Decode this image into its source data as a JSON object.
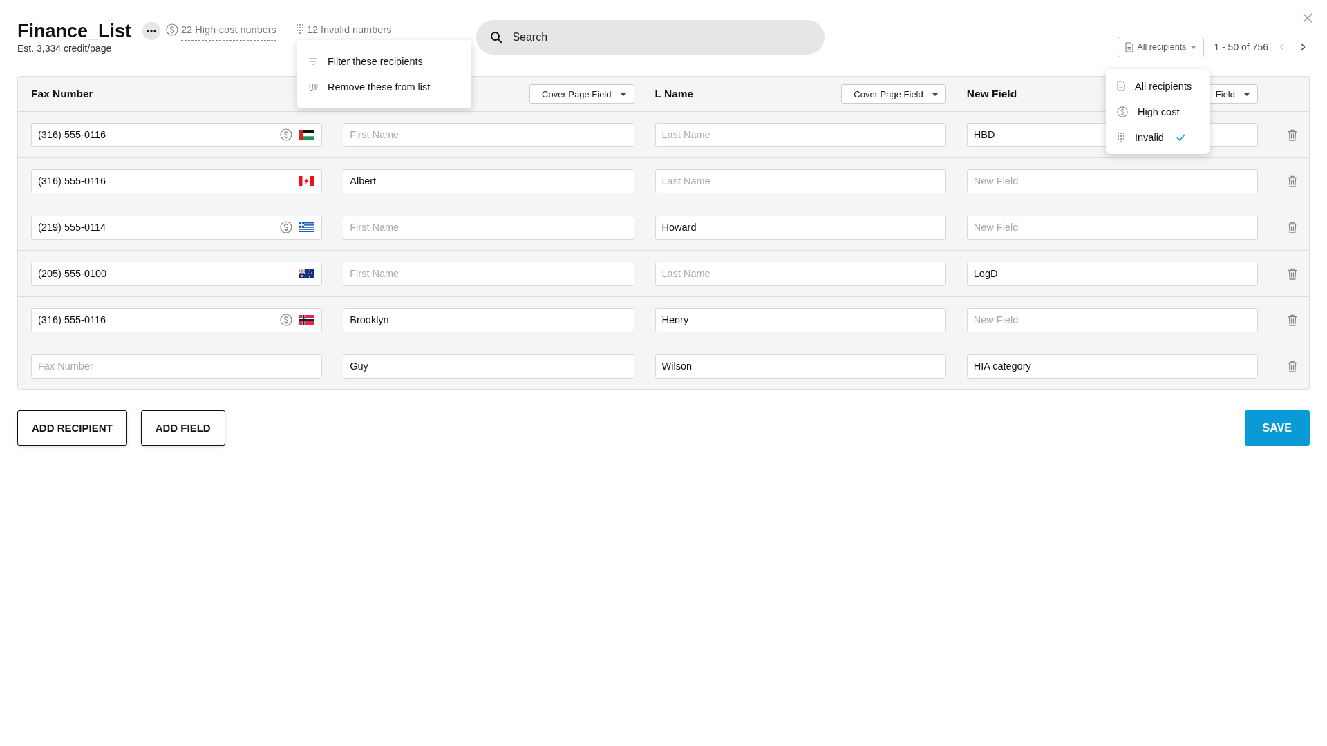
{
  "header": {
    "title": "Finance_List",
    "subtitle": "Est. 3,334 credit/page",
    "high_cost_label": "22 High-cost nunbers",
    "invalid_label": "12 Invalid numbers"
  },
  "invalid_menu": {
    "items": [
      {
        "kind": "filter",
        "label": "Filter these recipients"
      },
      {
        "kind": "remove",
        "label": "Remove these from list"
      }
    ]
  },
  "search": {
    "placeholder": "Search"
  },
  "filter": {
    "label": "All recipients",
    "options": [
      {
        "kind": "all",
        "label": "All recipients",
        "selected": false
      },
      {
        "kind": "high_cost",
        "label": "High cost",
        "selected": false
      },
      {
        "kind": "invalid",
        "label": "Invalid",
        "selected": true
      }
    ]
  },
  "pagination": {
    "range": "1 - 50 of 756",
    "prev_disabled": true
  },
  "table": {
    "columns": [
      {
        "label": "Fax Number"
      },
      {
        "field_select": "Cover Page Field"
      },
      {
        "label": "L Name",
        "field_select": "Cover Page Field"
      },
      {
        "label": "New Field",
        "field_select": "Field"
      }
    ],
    "rows": [
      {
        "cells": [
          {
            "value": "(316) 555-0116",
            "high_cost": true,
            "flag": {
              "kind": "ae"
            }
          },
          {
            "placeholder": "First Name"
          },
          {
            "placeholder": "Last Name"
          },
          {
            "value": "HBD"
          }
        ]
      },
      {
        "cells": [
          {
            "value": "(316) 555-0116",
            "high_cost": false,
            "flag": {
              "kind": "ca"
            }
          },
          {
            "value": "Albert"
          },
          {
            "placeholder": "Last Name"
          },
          {
            "placeholder": "New Field"
          }
        ]
      },
      {
        "cells": [
          {
            "value": "(219) 555-0114",
            "high_cost": true,
            "flag": {
              "kind": "gr"
            }
          },
          {
            "placeholder": "First Name"
          },
          {
            "value": "Howard"
          },
          {
            "placeholder": "New Field"
          }
        ]
      },
      {
        "cells": [
          {
            "value": "(205) 555-0100",
            "high_cost": false,
            "flag": {
              "kind": "au"
            }
          },
          {
            "placeholder": "First Name"
          },
          {
            "placeholder": "Last Name"
          },
          {
            "value": "LogD"
          }
        ]
      },
      {
        "cells": [
          {
            "value": "(316) 555-0116",
            "high_cost": true,
            "flag": {
              "kind": "no"
            }
          },
          {
            "value": "Brooklyn"
          },
          {
            "value": "Henry"
          },
          {
            "placeholder": "New Field"
          }
        ]
      },
      {
        "cells": [
          {
            "placeholder": "Fax Number",
            "high_cost": false
          },
          {
            "value": "Guy"
          },
          {
            "value": "Wilson"
          },
          {
            "value": "HIA category"
          }
        ]
      }
    ]
  },
  "buttons": [
    {
      "kind": "outline",
      "label": "ADD RECIPIENT"
    },
    {
      "kind": "outline",
      "label": "ADD FIELD"
    },
    {
      "kind": "primary",
      "label": "SAVE"
    }
  ]
}
